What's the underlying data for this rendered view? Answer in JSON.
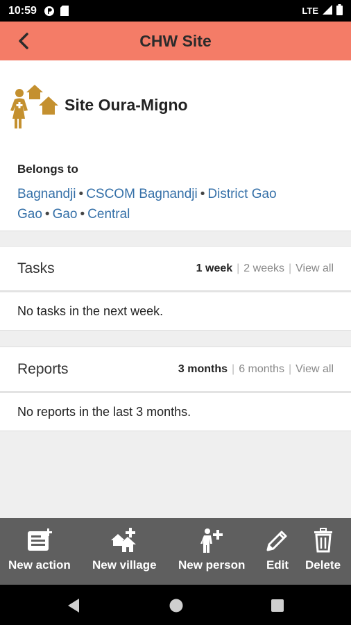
{
  "status_bar": {
    "time": "10:59",
    "network": "LTE"
  },
  "app_bar": {
    "title": "CHW Site"
  },
  "place": {
    "name": "Site Oura-Migno",
    "belongs_to_label": "Belongs to",
    "lineage": [
      "Bagnandji",
      "CSCOM Bagnandji",
      "District Gao",
      "Gao",
      "Central"
    ]
  },
  "tasks": {
    "label": "Tasks",
    "filters": [
      "1 week",
      "2 weeks",
      "View all"
    ],
    "active_filter": "1 week",
    "empty_text": "No tasks in the next week."
  },
  "reports": {
    "label": "Reports",
    "filters": [
      "3 months",
      "6 months",
      "View all"
    ],
    "active_filter": "3 months",
    "empty_text": "No reports in the last 3 months."
  },
  "actions": [
    {
      "label": "New action",
      "icon": "new-action-icon"
    },
    {
      "label": "New village",
      "icon": "new-village-icon"
    },
    {
      "label": "New person",
      "icon": "new-person-icon"
    },
    {
      "label": "Edit",
      "icon": "edit-icon"
    },
    {
      "label": "Delete",
      "icon": "delete-icon"
    }
  ],
  "colors": {
    "app_bar": "#f47c67",
    "link": "#3570a8",
    "icon_gold": "#c4902f",
    "action_bar": "#5f5f5f"
  }
}
